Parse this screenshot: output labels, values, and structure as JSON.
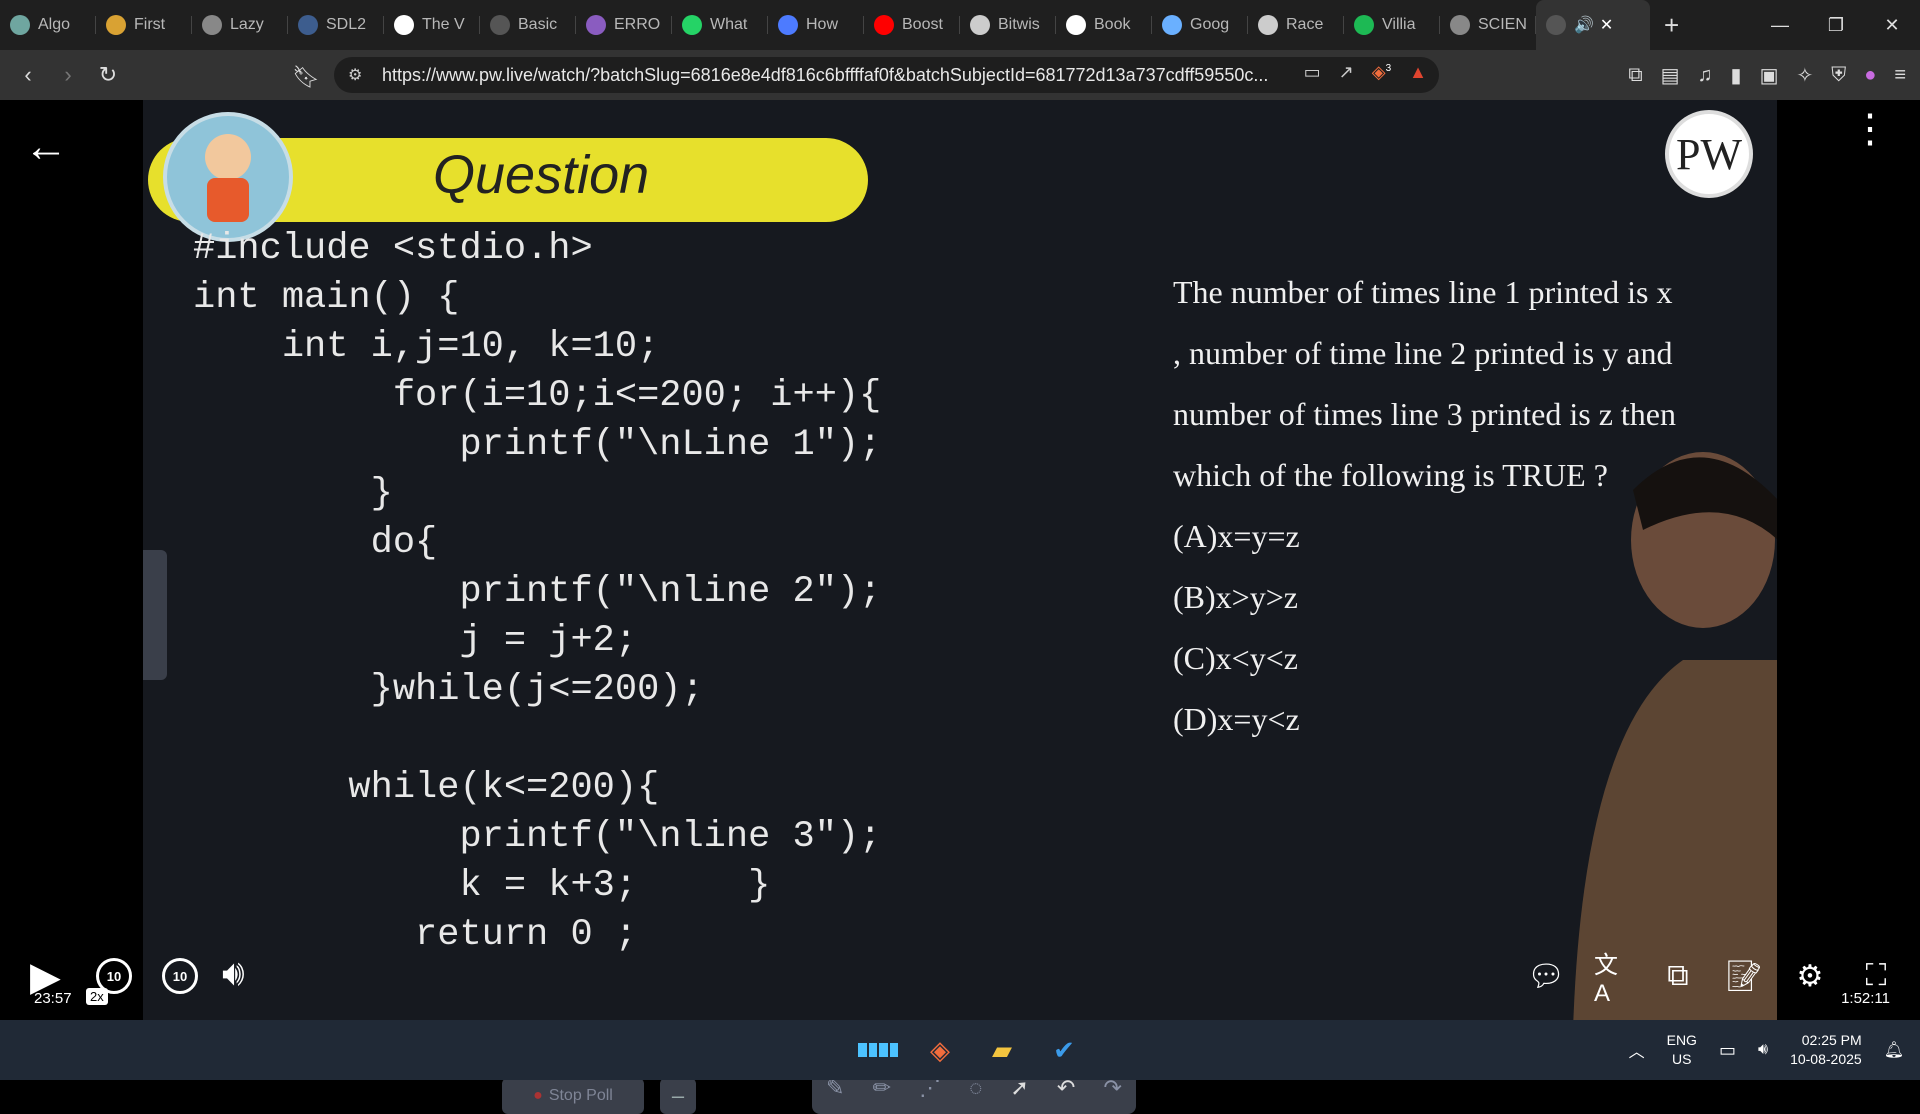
{
  "browser": {
    "tabs": [
      {
        "label": "Algo",
        "icon": "chatgpt-icon",
        "color": "#6fa6a0"
      },
      {
        "label": "First",
        "icon": "pw-icon",
        "color": "#d9a233"
      },
      {
        "label": "Lazy",
        "icon": "globe-icon",
        "color": "#888"
      },
      {
        "label": "SDL2",
        "icon": "sdl-icon",
        "color": "#3d5d8e"
      },
      {
        "label": "The V",
        "icon": "w3schools-icon",
        "color": "#fff"
      },
      {
        "label": "Basic",
        "icon": "geeks-icon",
        "color": "#555"
      },
      {
        "label": "ERRO",
        "icon": "deepseek-icon",
        "color": "#8a5cc0"
      },
      {
        "label": "What",
        "icon": "whatsapp-icon",
        "color": "#25d366"
      },
      {
        "label": "How",
        "icon": "copilot-icon",
        "color": "#4d7bff"
      },
      {
        "label": "Boost",
        "icon": "youtube-icon",
        "color": "#ff0000"
      },
      {
        "label": "Bitwis",
        "icon": "orkg-icon",
        "color": "#ccc"
      },
      {
        "label": "Book",
        "icon": "google-icon",
        "color": "#fff"
      },
      {
        "label": "Goog",
        "icon": "gemini-icon",
        "color": "#6ab0ff"
      },
      {
        "label": "Race",
        "icon": "openai-icon",
        "color": "#ccc"
      },
      {
        "label": "Villia",
        "icon": "spotify-icon",
        "color": "#1db954"
      },
      {
        "label": "SCIEN",
        "icon": "globe-icon",
        "color": "#888"
      }
    ],
    "active_tab": {
      "label": "",
      "icon": "pw-tab-icon"
    },
    "new_tab": "+",
    "url": "https://www.pw.live/watch/?batchSlug=6816e8e4df816c6bffffaf0f&batchSubjectId=681772d13a737cdff59550c...",
    "brave_badge": "3"
  },
  "slide": {
    "title": "Question",
    "logo": "PW",
    "code_lines": [
      "#include <stdio.h>",
      "int main() {",
      "    int i,j=10, k=10;",
      "         for(i=10;i<=200; i++){",
      "            printf(\"\\nLine 1\");",
      "        }",
      "        do{",
      "            printf(\"\\nline 2\");",
      "            j = j+2;",
      "        }while(j<=200);",
      "",
      "       while(k<=200){",
      "            printf(\"\\nline 3\");",
      "            k = k+3;     }",
      "          return 0 ;"
    ],
    "question_lines": [
      "The number of times line 1 printed is x",
      ", number of time line 2 printed is y and",
      "number of times line 3 printed is z then",
      "which of the following is TRUE ?"
    ],
    "options": [
      "(A)x=y=z",
      "(B)x>y>z",
      "(C)x<y<z",
      "(D)x=y<z"
    ]
  },
  "player": {
    "current_time": "23:57",
    "speed": "2x",
    "total_time": "1:52:11",
    "progress": 0.213,
    "rewind_label": "10",
    "forward_label": "10",
    "stop_poll": "Stop Poll",
    "minus": "–"
  },
  "taskbar": {
    "lang_top": "ENG",
    "lang_bottom": "US",
    "time": "02:25 PM",
    "date": "10-08-2025"
  }
}
